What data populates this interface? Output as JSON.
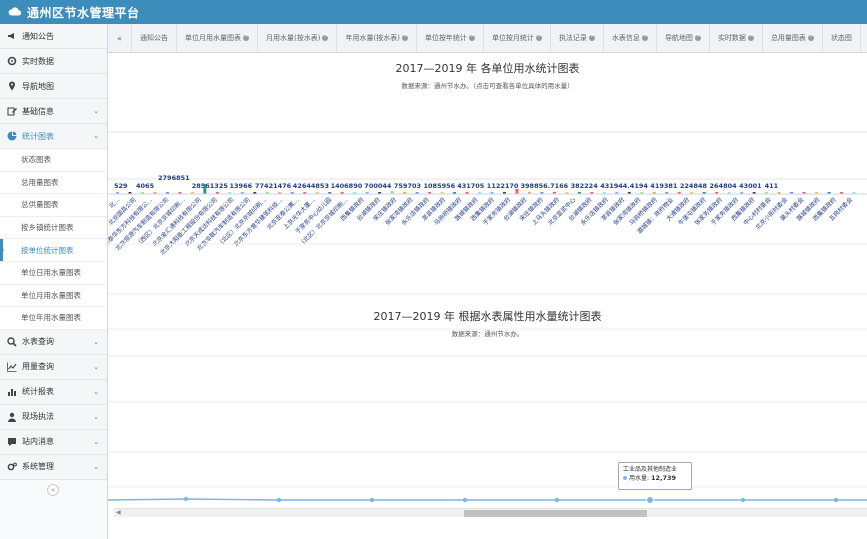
{
  "app": {
    "title": "通州区节水管理平台"
  },
  "sidebar": {
    "items": [
      {
        "label": "通知公告",
        "icon": "bullhorn-icon"
      },
      {
        "label": "实时数据",
        "icon": "gear-icon"
      },
      {
        "label": "导航地图",
        "icon": "map-pin-icon"
      },
      {
        "label": "基础信息",
        "icon": "edit-icon"
      },
      {
        "label": "统计图表",
        "icon": "pie-chart-icon"
      }
    ],
    "submenu": [
      {
        "label": "状态图表"
      },
      {
        "label": "总用量图表"
      },
      {
        "label": "总供量图表"
      },
      {
        "label": "按乡镇统计图表"
      },
      {
        "label": "按单位统计图表"
      },
      {
        "label": "单位日用水量图表"
      },
      {
        "label": "单位月用水量图表"
      },
      {
        "label": "单位年用水量图表"
      }
    ],
    "bottom_items": [
      {
        "label": "水表查询",
        "icon": "search-icon"
      },
      {
        "label": "用量查询",
        "icon": "line-chart-icon"
      },
      {
        "label": "统计报表",
        "icon": "bar-chart-icon"
      },
      {
        "label": "现场执法",
        "icon": "user-icon"
      },
      {
        "label": "站内消息",
        "icon": "chat-icon"
      },
      {
        "label": "系统管理",
        "icon": "cogs-icon"
      }
    ]
  },
  "tabs": [
    {
      "label": "通知公告",
      "closable": false
    },
    {
      "label": "单位月用水量图表",
      "closable": true
    },
    {
      "label": "月用水量(按水表)",
      "closable": true
    },
    {
      "label": "年用水量(按水表)",
      "closable": true
    },
    {
      "label": "单位按年统计",
      "closable": true
    },
    {
      "label": "单位按月统计",
      "closable": true
    },
    {
      "label": "执法记录",
      "closable": true
    },
    {
      "label": "水表信息",
      "closable": true
    },
    {
      "label": "导航地图",
      "closable": true
    },
    {
      "label": "实时数据",
      "closable": true
    },
    {
      "label": "总用量图表",
      "closable": true
    },
    {
      "label": "状态图",
      "closable": false
    }
  ],
  "charts": {
    "chart1_title": "2017—2019 年 各单位用水统计图表",
    "chart1_subtitle": "数据来源：通州节水办。（点击可查看各单位具体的用水量）",
    "chart2_title": "2017—2019 年 根据水表属性用水量统计图表",
    "chart2_subtitle": "数据来源：通州节水办。"
  },
  "tooltip": {
    "category": "工业品及其他制造业",
    "series": "用水量",
    "value": "12,739"
  },
  "chart_data": [
    {
      "type": "bar",
      "title": "2017—2019 年 各单位用水统计图表",
      "subtitle": "数据来源：通州节水办。（点击可查看各单位具体的用水量）",
      "categories": [
        "北…",
        "北京国昌公司",
        "北京泰华东方科技有限公…",
        "北京恒源汽车制造有限公司",
        "（西区）北京京城印刷…",
        "北京金汇通科技有限公司",
        "北京太阳能工程股份有限公司",
        "北京天成达科技有限公司",
        "北京华联汽车制造有限公司",
        "（北区）北京京城印刷…",
        "北京东方普华建筑科技…",
        "北京亚泰公寓…",
        "上京光华大厦…",
        "于家务中心幼儿园",
        "（北区）北京京城印刷…",
        "西集镇政府",
        "台湖镇政府",
        "宋庄镇政府",
        "张家湾镇政府",
        "永乐店镇政府",
        "漷县镇政府",
        "马驹桥镇政府",
        "潞城镇政府",
        "西集镇政府",
        "于家务镇政府",
        "台湖镇政府",
        "宋庄镇政府",
        "上马头镇政府",
        "北京宣武中心",
        "台湖镇政府",
        "永乐店镇政府",
        "漷县镇政府",
        "张家湾镇政府",
        "马驹桥镇政府",
        "潞城镇：政府物业",
        "大通镇政府",
        "牛堡屯镇政府",
        "张家务镇政府",
        "于家务镇政府",
        "西集镇政府",
        "中心村村委会",
        "北京小街村委会",
        "渠头村委会",
        "潞城镇政府",
        "西集镇政府",
        "五岗村委会"
      ],
      "values": [
        529,
        4065,
        2796851,
        28561325,
        13966,
        77421476,
        42644853,
        0,
        0,
        0,
        0,
        0,
        1406890,
        0,
        0,
        700044,
        759703,
        0,
        1085956,
        0,
        431705,
        1122170,
        0,
        0,
        398856.7166,
        0,
        382224,
        0,
        431944.4194,
        0,
        419381,
        224848,
        0,
        264804,
        43001,
        0
      ],
      "data_labels": [
        "529",
        "4065",
        "2796851",
        "28561325",
        "13966",
        "77421476",
        "42644853",
        "1406890",
        "700044",
        "759703",
        "1085956",
        "431705",
        "1122170",
        "398856.7166",
        "382224",
        "431944.4194",
        "419381",
        "224848",
        "264804",
        "43001",
        "411"
      ]
    },
    {
      "type": "line",
      "title": "2017—2019 年 根据水表属性用水量统计图表",
      "subtitle": "数据来源：通州节水办。",
      "series": [
        {
          "name": "用水量",
          "points_count": 9
        }
      ],
      "highlighted": {
        "category": "工业品及其他制造业",
        "value": 12739
      }
    }
  ]
}
